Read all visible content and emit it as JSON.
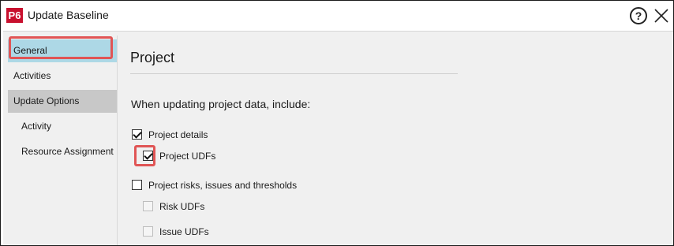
{
  "window": {
    "title": "Update Baseline",
    "logo_text": "P6",
    "help_symbol": "?",
    "colors": {
      "logo": "#c8102e",
      "selected_nav": "#add8e6",
      "highlight": "#e05555"
    }
  },
  "sidebar": {
    "items": [
      {
        "label": "General",
        "state": "selected"
      },
      {
        "label": "Activities",
        "state": "normal"
      },
      {
        "label": "Update Options",
        "state": "group"
      },
      {
        "label": "Activity",
        "state": "sub"
      },
      {
        "label": "Resource Assignment",
        "state": "sub"
      }
    ]
  },
  "main": {
    "section_title": "Project",
    "lead_text": "When updating project data, include:",
    "options": [
      {
        "label": "Project details",
        "checked": true,
        "enabled": true
      },
      {
        "label": "Project UDFs",
        "checked": true,
        "enabled": true
      },
      {
        "label": "Project risks, issues and thresholds",
        "checked": false,
        "enabled": true
      },
      {
        "label": "Risk UDFs",
        "checked": false,
        "enabled": false
      },
      {
        "label": "Issue UDFs",
        "checked": false,
        "enabled": false
      }
    ]
  }
}
